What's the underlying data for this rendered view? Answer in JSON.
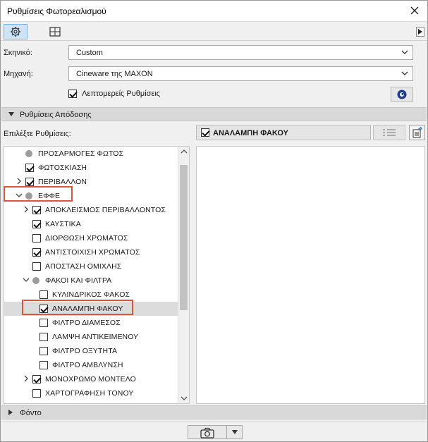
{
  "window": {
    "title": "Ρυθμίσεις Φωτορεαλισμού"
  },
  "tabs": [
    {
      "icon": "gear-icon",
      "active": true
    },
    {
      "icon": "grid-frame-icon",
      "active": false
    }
  ],
  "form": {
    "scene_label": "Σκηνικό:",
    "scene_value": "Custom",
    "engine_label": "Μηχανή:",
    "engine_value": "Cineware της MAXON",
    "detailed_settings_label": "Λεπτομερείς Ρυθμίσεις",
    "detailed_settings_checked": true
  },
  "render_section": {
    "label": "Ρυθμίσεις Απόδοσης",
    "expanded": true
  },
  "choose_label": "Επιλέξτε Ρυθμίσεις:",
  "tree": {
    "items": [
      {
        "label": "ΠΡΟΣΑΡΜΟΓΕΣ ΦΩΤΟΣ",
        "kind": "dot",
        "level": 1,
        "expander": ""
      },
      {
        "label": "ΦΩΤΟΣΚΙΑΣΗ",
        "kind": "check",
        "checked": true,
        "level": 1,
        "expander": ""
      },
      {
        "label": "ΠΕΡΙΒΑΛΛΟΝ",
        "kind": "check",
        "checked": true,
        "level": 1,
        "expander": "collapsed"
      },
      {
        "label": "ΕΦΦΕ",
        "kind": "dot",
        "level": 1,
        "expander": "expanded"
      },
      {
        "label": "ΑΠΟΚΛΕΙΣΜΟΣ ΠΕΡΙΒΑΛΛΟΝΤΟΣ",
        "kind": "check",
        "checked": true,
        "level": 2,
        "expander": "collapsed"
      },
      {
        "label": "ΚΑΥΣΤΙΚΑ",
        "kind": "check",
        "checked": true,
        "level": 2,
        "expander": ""
      },
      {
        "label": "ΔΙΟΡΘΩΣΗ ΧΡΩΜΑΤΟΣ",
        "kind": "check",
        "checked": false,
        "level": 2,
        "expander": ""
      },
      {
        "label": "ΑΝΤΙΣΤΟΙΧΙΣΗ ΧΡΩΜΑΤΟΣ",
        "kind": "check",
        "checked": true,
        "level": 2,
        "expander": ""
      },
      {
        "label": "ΑΠΟΣΤΑΣΗ ΟΜΙΧΛΗΣ",
        "kind": "check",
        "checked": false,
        "level": 2,
        "expander": ""
      },
      {
        "label": "ΦΑΚΟΙ ΚΑΙ ΦΙΛΤΡΑ",
        "kind": "dot",
        "level": 2,
        "expander": "expanded"
      },
      {
        "label": "ΚΥΛΙΝΔΡΙΚΟΣ ΦΑΚΟΣ",
        "kind": "check",
        "checked": false,
        "level": 3,
        "expander": ""
      },
      {
        "label": "ΑΝΑΛΑΜΠΗ ΦΑΚΟΥ",
        "kind": "check",
        "checked": true,
        "level": 3,
        "expander": "",
        "selected": true
      },
      {
        "label": "ΦΙΛΤΡΟ ΔΙΑΜΕΣΟΣ",
        "kind": "check",
        "checked": false,
        "level": 3,
        "expander": ""
      },
      {
        "label": "ΛΑΜΨΗ ΑΝΤΙΚΕΙΜΕΝΟΥ",
        "kind": "check",
        "checked": false,
        "level": 3,
        "expander": ""
      },
      {
        "label": "ΦΙΛΤΡΟ ΟΞΥΤΗΤΑ",
        "kind": "check",
        "checked": false,
        "level": 3,
        "expander": ""
      },
      {
        "label": "ΦΙΛΤΡΟ ΑΜΒΛΥΝΣΗ",
        "kind": "check",
        "checked": false,
        "level": 3,
        "expander": ""
      },
      {
        "label": "ΜΟΝΟΧΡΩΜΟ ΜΟΝΤΕΛΟ",
        "kind": "check",
        "checked": true,
        "level": 2,
        "expander": "collapsed"
      },
      {
        "label": "ΧΑΡΤΟΓΡΑΦΗΣΗ ΤΟΝΟΥ",
        "kind": "check",
        "checked": false,
        "level": 2,
        "expander": ""
      }
    ]
  },
  "right_panel": {
    "header_label": "ΑΝΑΛΑΜΠΗ ΦΑΚΟΥ",
    "header_checked": true
  },
  "background_section": {
    "label": "Φόντο",
    "expanded": false
  },
  "colors": {
    "highlight": "#d9573a",
    "selection": "#dcdcdc",
    "tab_active": "#cfe3f7"
  }
}
